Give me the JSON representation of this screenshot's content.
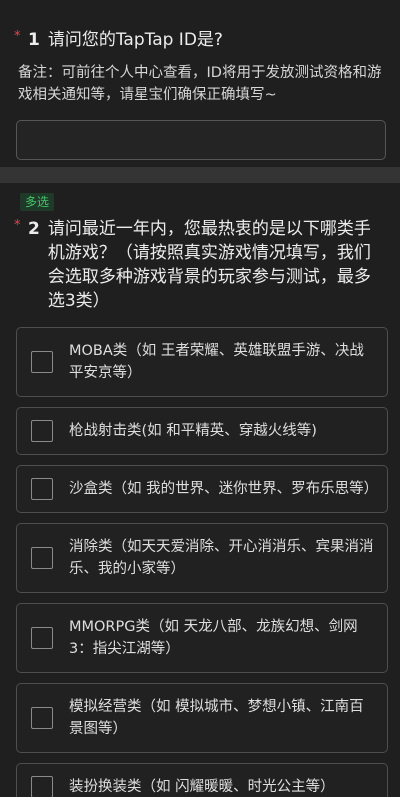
{
  "question1": {
    "required_mark": "*",
    "number": "1",
    "title": "请问您的TapTap ID是?",
    "note": "备注：可前往个人中心查看，ID将用于发放测试资格和游戏相关通知等，请星宝们确保正确填写~",
    "input_value": ""
  },
  "question2": {
    "badge": "多选",
    "required_mark": "*",
    "number": "2",
    "title": "请问最近一年内，您最热衷的是以下哪类手机游戏？（请按照真实游戏情况填写，我们会选取多种游戏背景的玩家参与测试，最多选3类）",
    "options": [
      {
        "label": "MOBA类（如 王者荣耀、英雄联盟手游、决战平安京等）",
        "checked": false
      },
      {
        "label": "枪战射击类(如 和平精英、穿越火线等)",
        "checked": false
      },
      {
        "label": "沙盒类（如 我的世界、迷你世界、罗布乐思等）",
        "checked": false
      },
      {
        "label": "消除类（如天天爱消除、开心消消乐、宾果消消乐、我的小家等）",
        "checked": false
      },
      {
        "label": "MMORPG类（如 天龙八部、龙族幻想、剑网3：指尖江湖等）",
        "checked": false
      },
      {
        "label": "模拟经营类（如 模拟城市、梦想小镇、江南百景图等）",
        "checked": false
      },
      {
        "label": "装扮换装类（如 闪耀暖暖、时光公主等）",
        "checked": false
      }
    ]
  },
  "colors": {
    "background": "#1f1f1f",
    "required": "#e5484d",
    "badge_text": "#45c46a",
    "badge_bg": "#1f3a28",
    "border": "#4e4e4e"
  }
}
